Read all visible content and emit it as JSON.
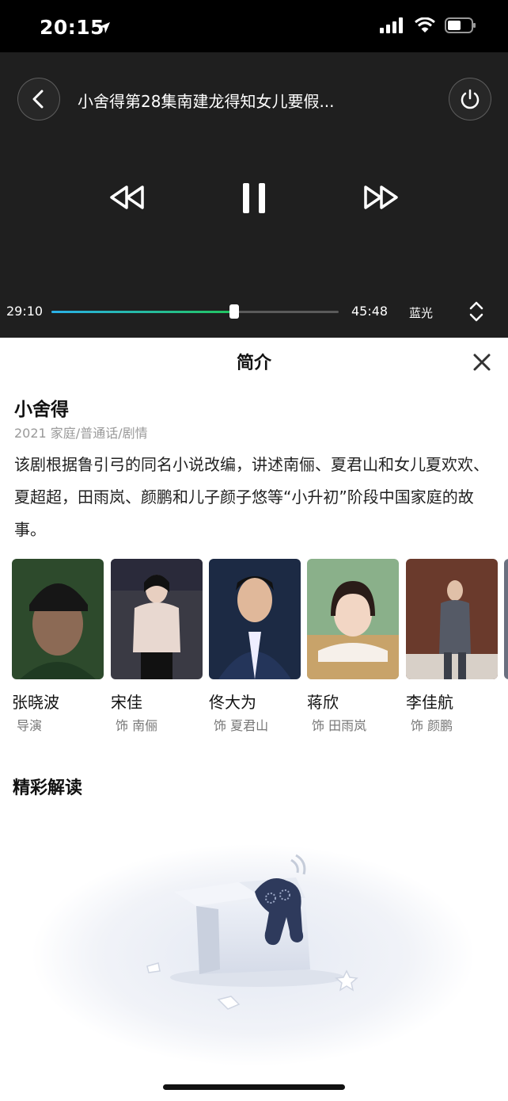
{
  "status_bar": {
    "time": "20:15"
  },
  "player": {
    "title": "小舍得第28集南建龙得知女儿要假...",
    "current_time": "29:10",
    "total_time": "45:48",
    "progress": 0.636,
    "quality": "蓝光"
  },
  "panel": {
    "title": "简介",
    "show_title": "小舍得",
    "meta": "2021 家庭/普通话/剧情",
    "synopsis": "该剧根据鲁引弓的同名小说改编，讲述南俪、夏君山和女儿夏欢欢、夏超超，田雨岚、颜鹏和儿子颜子悠等“小升初”阶段中国家庭的故事。"
  },
  "cast": [
    {
      "name": "张晓波",
      "role": "导演",
      "bg": "#2d4a2c",
      "fg": "#8c6a55"
    },
    {
      "name": "宋佳",
      "role": "饰 南俪",
      "bg": "#3a3a44",
      "fg": "#e8d8d0"
    },
    {
      "name": "佟大为",
      "role": "饰 夏君山",
      "bg": "#1c2a44",
      "fg": "#e0b89a"
    },
    {
      "name": "蒋欣",
      "role": "饰 田雨岚",
      "bg": "#c8a36a",
      "fg": "#f2d6c4"
    },
    {
      "name": "李佳航",
      "role": "饰 颜鹏",
      "bg": "#6a3a2c",
      "fg": "#555a66"
    }
  ],
  "section": {
    "title": "精彩解读"
  },
  "colors": {
    "progress_start": "#2ab0e8",
    "progress_end": "#22c55e",
    "player_bg": "#1f1f1f"
  }
}
